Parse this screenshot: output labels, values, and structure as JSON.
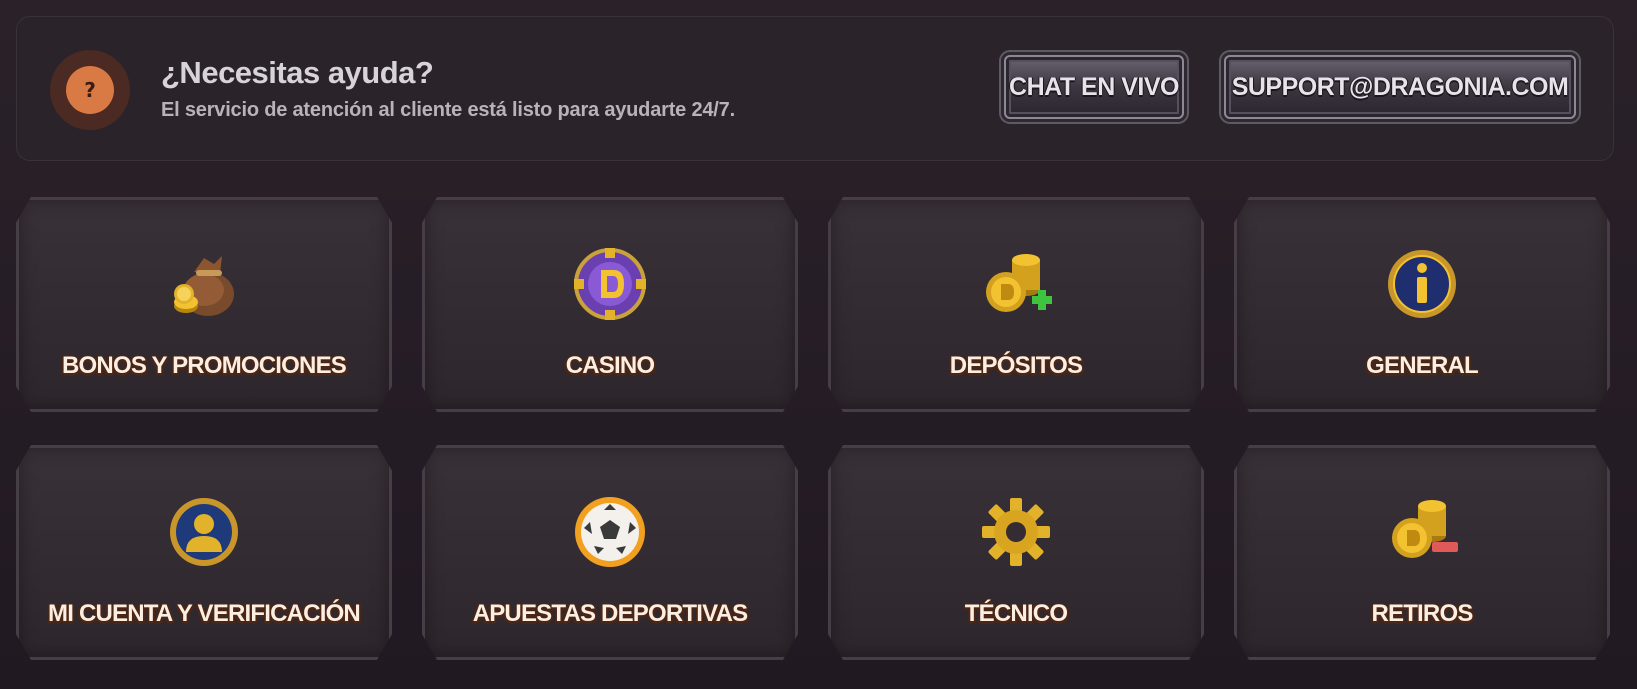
{
  "help": {
    "icon_glyph": "?",
    "title": "¿Necesitas ayuda?",
    "subtitle": "El servicio de atención al cliente está listo para ayudarte 24/7.",
    "chat_label": "CHAT EN VIVO",
    "email_label": "SUPPORT@DRAGONIA.COM"
  },
  "categories": [
    {
      "label": "BONOS Y PROMOCIONES",
      "icon": "money-bag-icon"
    },
    {
      "label": "CASINO",
      "icon": "casino-chip-icon"
    },
    {
      "label": "DEPÓSITOS",
      "icon": "coins-plus-icon"
    },
    {
      "label": "GENERAL",
      "icon": "info-icon"
    },
    {
      "label": "MI CUENTA Y VERIFICACIÓN",
      "icon": "user-account-icon"
    },
    {
      "label": "APUESTAS DEPORTIVAS",
      "icon": "soccer-ball-icon"
    },
    {
      "label": "TÉCNICO",
      "icon": "gear-icon"
    },
    {
      "label": "RETIROS",
      "icon": "coins-minus-icon"
    }
  ],
  "colors": {
    "accent_orange": "#d97a44",
    "label_text": "#fbeee2",
    "label_outline": "#4a2616",
    "gold": "#e2b32a",
    "background": "#221a22"
  }
}
